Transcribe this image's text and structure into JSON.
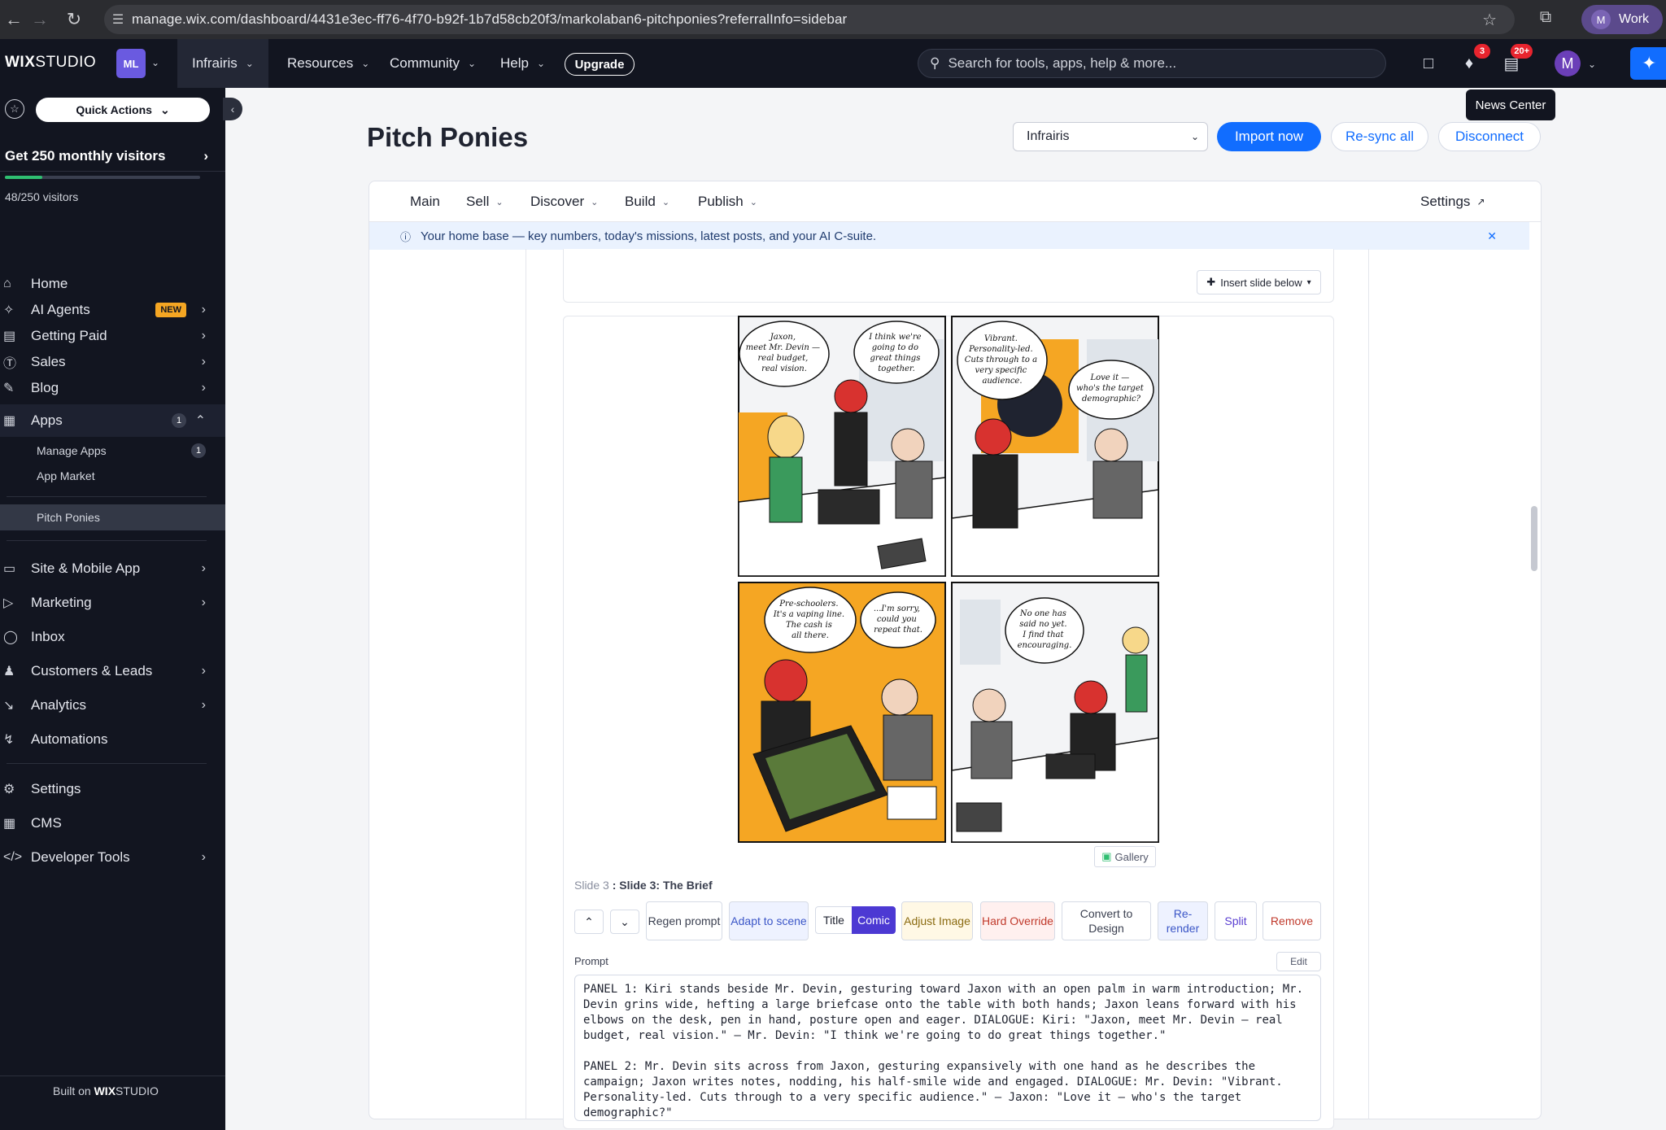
{
  "browser": {
    "url": "manage.wix.com/dashboard/4431e3ec-ff76-4f70-b92f-1b7d58cb20f3/markolaban6-pitchponies?referralInfo=sidebar",
    "profile_initial": "M",
    "profile_label": "Work"
  },
  "topbar": {
    "logo_bold": "WIX",
    "logo_rest": "STUDIO",
    "site_initials": "ML",
    "site_name": "Infrairis",
    "menu": [
      "Resources",
      "Community",
      "Help"
    ],
    "upgrade_label": "Upgrade",
    "search_placeholder": "Search for tools, apps, help & more...",
    "notifications_count": "3",
    "news_count": "20+",
    "user_initial": "M",
    "tooltip": "News Center"
  },
  "sidebar": {
    "quick_actions": "Quick Actions",
    "visitors_title": "Get 250 monthly visitors",
    "visitors_count": "48/250 visitors",
    "visitors_progress": 0.192,
    "items": [
      {
        "label": "Home",
        "icon": "home-icon"
      },
      {
        "label": "AI Agents",
        "icon": "sparkle-icon",
        "badge": "NEW"
      },
      {
        "label": "Getting Paid",
        "icon": "receipt-icon"
      },
      {
        "label": "Sales",
        "icon": "dollar-icon"
      },
      {
        "label": "Blog",
        "icon": "pen-icon"
      },
      {
        "label": "Apps",
        "icon": "apps-icon",
        "count": "1"
      },
      {
        "label": "Site & Mobile App",
        "icon": "site-icon"
      },
      {
        "label": "Marketing",
        "icon": "megaphone-icon"
      },
      {
        "label": "Inbox",
        "icon": "inbox-icon"
      },
      {
        "label": "Customers & Leads",
        "icon": "people-icon"
      },
      {
        "label": "Analytics",
        "icon": "chart-icon"
      },
      {
        "label": "Automations",
        "icon": "bolt-icon"
      },
      {
        "label": "Settings",
        "icon": "gear-icon"
      },
      {
        "label": "CMS",
        "icon": "table-icon"
      },
      {
        "label": "Developer Tools",
        "icon": "code-icon"
      }
    ],
    "sub_items": [
      {
        "label": "Manage Apps",
        "count": "1"
      },
      {
        "label": "App Market"
      },
      {
        "label": "Pitch Ponies"
      }
    ],
    "built_on_prefix": "Built on",
    "built_on_brand": "WIX",
    "built_on_brand_rest": "STUDIO"
  },
  "header": {
    "title": "Pitch Ponies",
    "site_select": "Infrairis",
    "import_label": "Import now",
    "resync_label": "Re-sync all",
    "disconnect_label": "Disconnect"
  },
  "subnav": {
    "items": [
      "Main",
      "Sell",
      "Discover",
      "Build",
      "Publish"
    ],
    "settings": "Settings"
  },
  "info": {
    "text": "Your home base — key numbers, today's missions, latest posts, and your AI C-suite."
  },
  "slide": {
    "insert_label": "Insert slide below",
    "gallery_label": "Gallery",
    "number_label": "Slide 3",
    "title_label": ": Slide 3: The Brief",
    "toolbar": {
      "regen": "Regen prompt",
      "adapt": "Adapt to scene",
      "title": "Title",
      "comic": "Comic",
      "adjust": "Adjust Image",
      "hard": "Hard Override",
      "convert": "Convert to Design",
      "rerender": "Re-render",
      "split": "Split",
      "remove": "Remove"
    },
    "prompt_label": "Prompt",
    "edit_label": "Edit",
    "prompt_text": "PANEL 1: Kiri stands beside Mr. Devin, gesturing toward Jaxon with an open palm in warm introduction; Mr.\nDevin grins wide, hefting a large briefcase onto the table with both hands; Jaxon leans forward with his\nelbows on the desk, pen in hand, posture open and eager. DIALOGUE: Kiri: \"Jaxon, meet Mr. Devin — real\nbudget, real vision.\" — Mr. Devin: \"I think we're going to do great things together.\"\n\nPANEL 2: Mr. Devin sits across from Jaxon, gesturing expansively with one hand as he describes the\ncampaign; Jaxon writes notes, nodding, his half-smile wide and engaged. DIALOGUE: Mr. Devin: \"Vibrant.\nPersonality-led. Cuts through to a very specific audience.\" — Jaxon: \"Love it — who's the target\ndemographic?\"",
    "panels": [
      [
        "Jaxon,",
        "meet Mr. Devin —",
        "real budget,",
        "real vision."
      ],
      [
        "I think we're",
        "going to do",
        "great things",
        "together."
      ],
      [
        "Vibrant.",
        "Personality-led.",
        "Cuts through to a",
        "very specific",
        "audience."
      ],
      [
        "Love it —",
        "who's the target",
        "demographic?"
      ],
      [
        "Pre-schoolers.",
        "It's a vaping line.",
        "The cash is",
        "all there."
      ],
      [
        "...I'm sorry,",
        "could you",
        "repeat that."
      ],
      [
        "No one has",
        "said no yet.",
        "I find that",
        "encouraging."
      ]
    ]
  }
}
